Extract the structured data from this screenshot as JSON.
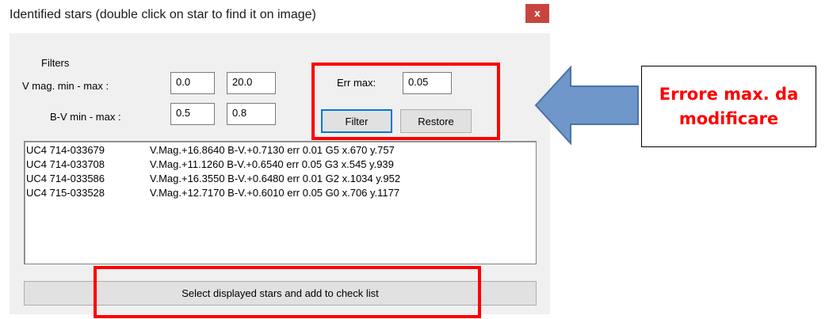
{
  "window": {
    "title": "Identified stars (double click on star to find it on image)",
    "close_label": "x"
  },
  "filters": {
    "group_label": "Filters",
    "vmag_label": "V mag. min - max :",
    "vmag_min": "0.0",
    "vmag_max": "20.0",
    "bv_label": "B-V min - max :",
    "bv_min": "0.5",
    "bv_max": "0.8",
    "err_label": "Err max:",
    "err_value": "0.05",
    "filter_button": "Filter",
    "restore_button": "Restore"
  },
  "stars": [
    {
      "id": "UC4 714-033679",
      "desc": "V.Mag.+16.8640 B-V.+0.7130 err 0.01  G5 x.670 y.757"
    },
    {
      "id": "UC4 714-033708",
      "desc": "V.Mag.+11.1260 B-V.+0.6540 err 0.05  G3 x.545 y.939"
    },
    {
      "id": "UC4 714-033586",
      "desc": "V.Mag.+16.3550 B-V.+0.6480 err 0.01  G2 x.1034 y.952"
    },
    {
      "id": "UC4 715-033528",
      "desc": "V.Mag.+12.7170 B-V.+0.6010 err 0.05  G0 x.706 y.1177"
    }
  ],
  "select_button": "Select displayed stars and add to check list",
  "annotation": {
    "line1": "Errore max. da",
    "line2": "modificare",
    "highlight_color": "#ff0000",
    "arrow_color": "#6f97c9"
  }
}
